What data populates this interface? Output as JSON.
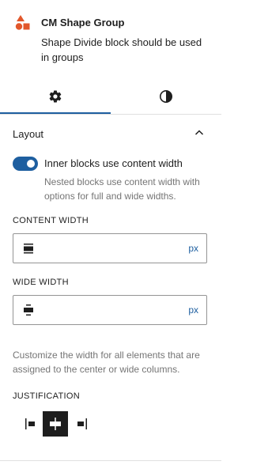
{
  "block": {
    "title": "CM Shape Group",
    "description": "Shape Divide block should be used in groups",
    "icon": "shapes-icon",
    "icon_color": "#e2572b"
  },
  "tabs": [
    {
      "name": "settings",
      "icon": "gear-icon",
      "active": true
    },
    {
      "name": "styles",
      "icon": "half-circle-icon",
      "active": false
    }
  ],
  "accent_color": "#1e5fa0",
  "layout": {
    "title": "Layout",
    "expanded": true,
    "toggle_label": "Inner blocks use content width",
    "toggle_on": true,
    "toggle_help": "Nested blocks use content width with options for full and wide widths.",
    "content_width": {
      "label": "CONTENT WIDTH",
      "value": "",
      "unit": "px"
    },
    "wide_width": {
      "label": "WIDE WIDTH",
      "value": "",
      "unit": "px"
    },
    "width_help": "Customize the width for all elements that are assigned to the center or wide columns.",
    "justification": {
      "label": "JUSTIFICATION",
      "options": [
        "left",
        "center",
        "right"
      ],
      "selected": "center"
    }
  }
}
